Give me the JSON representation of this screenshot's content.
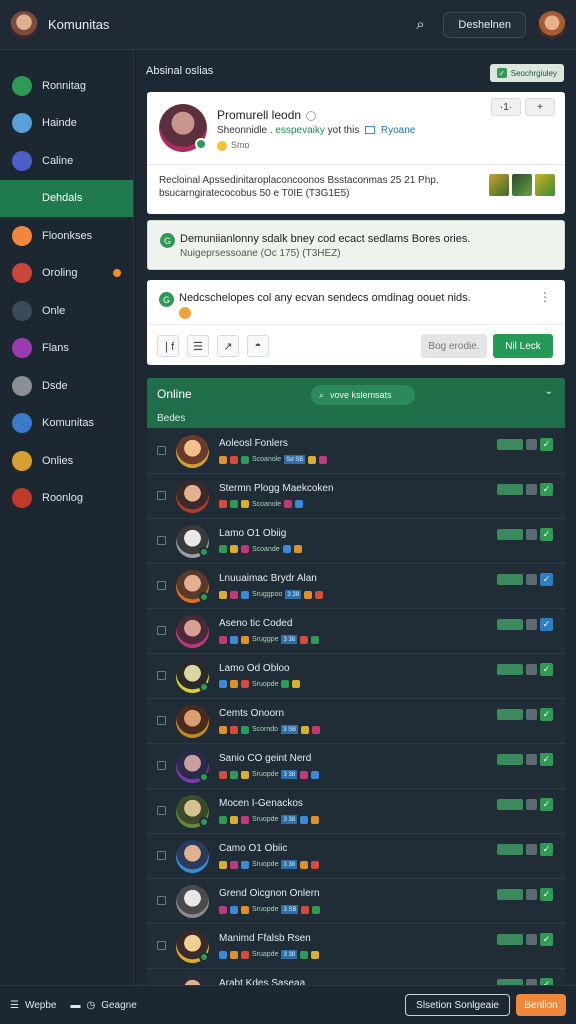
{
  "app": {
    "title": "Komunitas",
    "header_button": "Deshelnen"
  },
  "sidebar": {
    "items": [
      {
        "label": "Ronnitag",
        "icon": "community-icon",
        "color": "#2f9a55"
      },
      {
        "label": "Hainde",
        "icon": "books-icon",
        "color": "#5aa0d8"
      },
      {
        "label": "Caline",
        "icon": "star-icon",
        "color": "#4b5fc4"
      },
      {
        "label": "Dehdals",
        "icon": "dashboard-icon",
        "color": "#1f7a4d",
        "active": true
      },
      {
        "label": "Floonkses",
        "icon": "fire-icon",
        "color": "#f0873a"
      },
      {
        "label": "Oroling",
        "icon": "chest-icon",
        "color": "#c9463a",
        "badge": true
      },
      {
        "label": "Onle",
        "icon": "monitor-icon",
        "color": "#3a4a56"
      },
      {
        "label": "Flans",
        "icon": "orb-icon",
        "color": "#9a3ab0"
      },
      {
        "label": "Dsde",
        "icon": "avatar-icon",
        "color": "#8a8f94"
      },
      {
        "label": "Komunitas",
        "icon": "map-icon",
        "color": "#3a7ac8"
      },
      {
        "label": "Onlies",
        "icon": "globe-icon",
        "color": "#d8a030"
      },
      {
        "label": "Roonlog",
        "icon": "compass-icon",
        "color": "#c0392b"
      }
    ]
  },
  "main": {
    "section_title": "Absinal oslias",
    "section_button": "Seochrgiuley",
    "profile": {
      "name": "Promurell leodn",
      "line_start": "Sheonnidle .",
      "line_mid": "esspevaiky",
      "line_end": "yot this",
      "line_link": "Ryoane",
      "sub": "Smo",
      "ctrl_1": "·1·",
      "ctrl_2": "+",
      "desc": "Recloinal Apssedinitaroplaconcoonos Bsstaconmas 25 21 Php. bsucarngiratecocobus 50 e T0IE (T3G1E5)"
    },
    "notice": {
      "line1": "Demuniianlonny sdalk bney cod ecact sedlams Bores ories.",
      "line2": "Nuigeprsessoane (Oc 175) (T3HEZ)"
    },
    "composer": {
      "text": "Nedcschelopes col any ecvan sendecs omdinag oouet nids.",
      "secondary_button": "Bog erodie.",
      "primary_button": "Nil Leck",
      "tools": [
        "❘f",
        "☰",
        "↗",
        "◓"
      ]
    },
    "online": {
      "title": "Online",
      "subtitle": "Bedes",
      "search_label": "vove kslemsats",
      "members": [
        {
          "name": "Aoleosl Fonlers",
          "meta": "Scoanole",
          "tag": "Sd SB",
          "check": "green"
        },
        {
          "name": "Stermn Plogg Maekcoken",
          "meta": "Scoanole",
          "tag": "",
          "check": "green"
        },
        {
          "name": "Lamo O1 Obiig",
          "meta": "Scoande",
          "tag": "",
          "check": "green"
        },
        {
          "name": "Lnuuaimac Brydr Alan",
          "meta": "Sruggpoo",
          "tag": "3 38",
          "check": "blue"
        },
        {
          "name": "Aseno tic Coded",
          "meta": "Sruggpe",
          "tag": "3 38",
          "check": "blue"
        },
        {
          "name": "Lamo Od Obloo",
          "meta": "Sruopde",
          "tag": "",
          "check": "green"
        },
        {
          "name": "Cemts Onoorn",
          "meta": "Scorndo",
          "tag": "3 SB",
          "check": "green"
        },
        {
          "name": "Sanio CO geint Nerd",
          "meta": "Sruopde",
          "tag": "3 38",
          "check": "green"
        },
        {
          "name": "Mocen I-Genackos",
          "meta": "Sruopde",
          "tag": "3 38",
          "check": "green"
        },
        {
          "name": "Camo O1 Obiic",
          "meta": "Sruopde",
          "tag": "3 38",
          "check": "green"
        },
        {
          "name": "Grend Oicgnon Onlern",
          "meta": "Sruopde",
          "tag": "3 SB",
          "check": "green"
        },
        {
          "name": "Manimd Ffalsb Rsen",
          "meta": "Sruapde",
          "tag": "3 38",
          "check": "green"
        },
        {
          "name": "Arabt Kdes Saseaa",
          "meta": "",
          "tag": "",
          "check": "green"
        }
      ]
    }
  },
  "footer": {
    "left_1": "Wepbe",
    "left_2": "Geagne",
    "outline_button": "Slsetion Sonlgeaie",
    "primary_button": "Benlion"
  }
}
